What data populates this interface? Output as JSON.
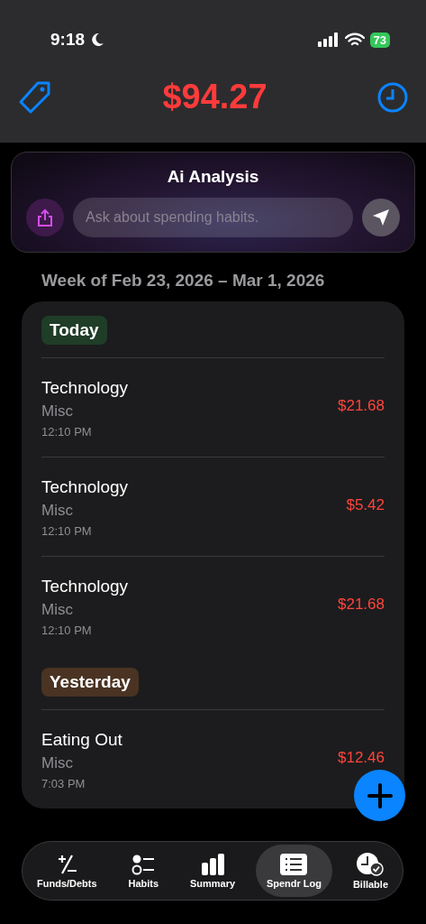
{
  "status_bar": {
    "time": "9:18",
    "battery": "73"
  },
  "header": {
    "total": "$94.27"
  },
  "ai_card": {
    "title": "Ai Analysis",
    "placeholder": "Ask about spending habits."
  },
  "week_label": "Week of Feb 23, 2026 – Mar 1, 2026",
  "groups": [
    {
      "label": "Today",
      "color": "#1f3d27",
      "entries": [
        {
          "category": "Technology",
          "note": "Misc",
          "time": "12:10 PM",
          "amount": "$21.68"
        },
        {
          "category": "Technology",
          "note": "Misc",
          "time": "12:10 PM",
          "amount": "$5.42"
        },
        {
          "category": "Technology",
          "note": "Misc",
          "time": "12:10 PM",
          "amount": "$21.68"
        }
      ]
    },
    {
      "label": "Yesterday",
      "color": "#4a3322",
      "entries": [
        {
          "category": "Eating Out",
          "note": "Misc",
          "time": "7:03 PM",
          "amount": "$12.46"
        }
      ]
    }
  ],
  "tab_bar": [
    {
      "label": "Funds/Debts",
      "kind": "plusminus",
      "selected": false
    },
    {
      "label": "Habits",
      "kind": "checklist",
      "selected": false
    },
    {
      "label": "Summary",
      "kind": "bars",
      "selected": false
    },
    {
      "label": "Spendr Log",
      "kind": "list",
      "selected": true
    },
    {
      "label": "Billable",
      "kind": "clockcheck",
      "selected": false
    }
  ]
}
